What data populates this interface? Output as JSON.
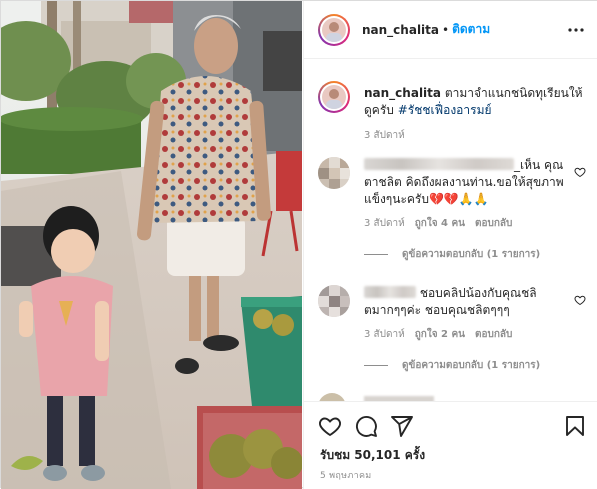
{
  "header": {
    "username": "nan_chalita",
    "dot": "•",
    "follow_label": "ติดตาม"
  },
  "caption": {
    "username": "nan_chalita",
    "text": "ตามาจำแนกชนิดทุเรียนให้ดูครับ",
    "hashtag": "#รัชชเฟื่องอารมย์",
    "time": "3 สัปดาห์"
  },
  "comments": [
    {
      "name_visible": "_เห็น",
      "text": "คุณตาชลิต คิดถึงผลงานท่าน.ขอให้สุขภาพแข็งๆนะครับ💔💔🙏🙏",
      "time": "3 สัปดาห์",
      "likes": "ถูกใจ 4 คน",
      "reply_label": "ตอบกลับ",
      "view_replies": "ดูข้อความตอบกลับ (1 รายการ)"
    },
    {
      "name_visible": "",
      "text": "ชอบคลิปน้องกับคุณชลิตมากๆๆค่ะ ชอบคุณชลิตๆๆๆ",
      "time": "3 สัปดาห์",
      "likes": "ถูกใจ 2 คน",
      "reply_label": "ตอบกลับ",
      "view_replies": "ดูข้อความตอบกลับ (1 รายการ)"
    }
  ],
  "actions": {
    "like_icon": "heart-outline-icon",
    "comment_icon": "comment-icon",
    "share_icon": "paper-plane-icon",
    "save_icon": "bookmark-icon"
  },
  "likes": "รับชม 50,101 ครั้ง",
  "date": "5 พฤษภาคม",
  "colors": {
    "follow_blue": "#0095f6",
    "hashtag": "#00376b",
    "meta_gray": "#8e8e8e",
    "text": "#262626"
  }
}
